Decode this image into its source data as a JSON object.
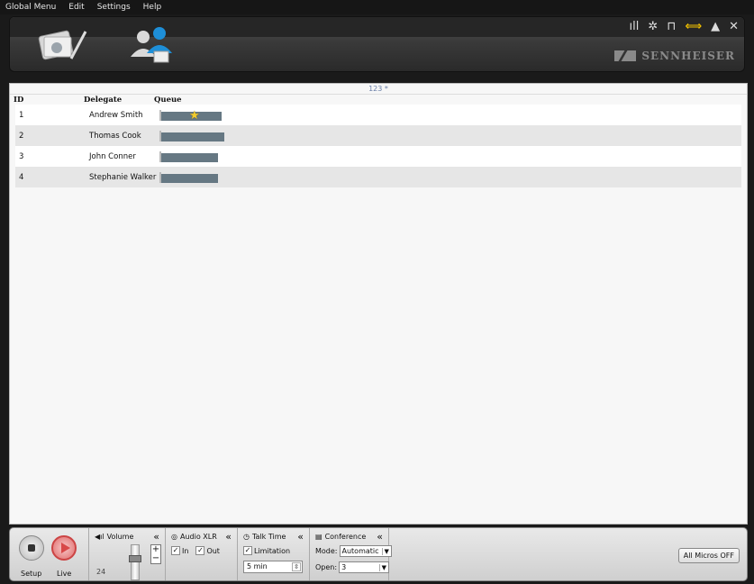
{
  "menu": [
    "Global Menu",
    "Edit",
    "Settings",
    "Help"
  ],
  "header": {
    "icons": [
      "conference-tools-icon",
      "delegates-icon"
    ],
    "toolbar_icons": [
      "signal-icon",
      "gear-icon",
      "unlock-icon",
      "swap-icon",
      "up-arrow-icon",
      "close-icon"
    ],
    "brand": "SENNHEISER"
  },
  "main": {
    "session_label": "123 *",
    "columns": [
      "ID",
      "Delegate",
      "Queue"
    ],
    "rows": [
      {
        "id": "1",
        "delegate": "Andrew Smith",
        "queue": 0.9,
        "starred": true
      },
      {
        "id": "2",
        "delegate": "Thomas Cook",
        "queue": 0.95,
        "starred": false
      },
      {
        "id": "3",
        "delegate": "John Conner",
        "queue": 0.85,
        "starred": false
      },
      {
        "id": "4",
        "delegate": "Stephanie Walker",
        "queue": 0.85,
        "starred": false
      }
    ]
  },
  "controls": {
    "setup_label": "Setup",
    "live_label": "Live",
    "volume_title": "Volume",
    "volume_value": "24",
    "audio_xlr_title": "Audio XLR",
    "in_label": "In",
    "out_label": "Out",
    "talk_time_title": "Talk Time",
    "limitation_label": "Limitation",
    "talk_time_value": "5 min",
    "conference_title": "Conference",
    "mode_label": "Mode:",
    "mode_value": "Automatic",
    "open_label": "Open:",
    "open_value": "3",
    "all_micros_off": "All Micros OFF"
  },
  "colors": {
    "queue_fill": "#667883",
    "star": "#f3cc2d",
    "live_accent": "#d84848",
    "brand_gray": "#8a8a8a"
  }
}
